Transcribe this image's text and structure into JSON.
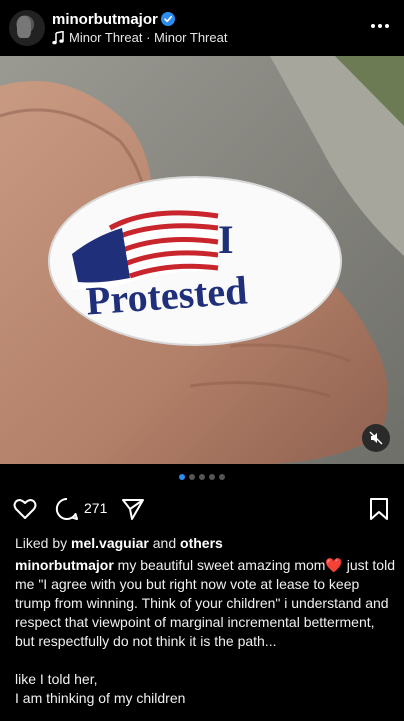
{
  "post": {
    "username": "minorbutmajor",
    "song": "Minor Threat · Minor Threat",
    "comment_count": "271",
    "liked_prefix": "Liked by",
    "liked_user": "mel.vaguiar",
    "liked_and": "and",
    "liked_others": "others",
    "caption_user": "minorbutmajor",
    "caption_text": "my beautiful sweet amazing mom❤️ just told me \"I agree with you but right now vote at lease to keep trump from winning. Think of your children\"  i understand and respect that viewpoint of marginal incremental betterment, but respectfully do not think it is the path...",
    "caption_line2": "like I told her,",
    "caption_line3": "I am thinking of my children"
  },
  "sticker": {
    "line1": "I",
    "line2": "Protested"
  },
  "carousel": {
    "total": 5,
    "active_index": 0
  },
  "colors": {
    "accent": "#2d8cf0",
    "sticker_blue": "#1f2f7a",
    "sticker_red": "#c8252d"
  },
  "icons": [
    "verified-badge-icon",
    "music-note-icon",
    "more-options-icon",
    "muted-speaker-icon",
    "heart-icon",
    "comment-icon",
    "share-icon",
    "bookmark-icon"
  ]
}
